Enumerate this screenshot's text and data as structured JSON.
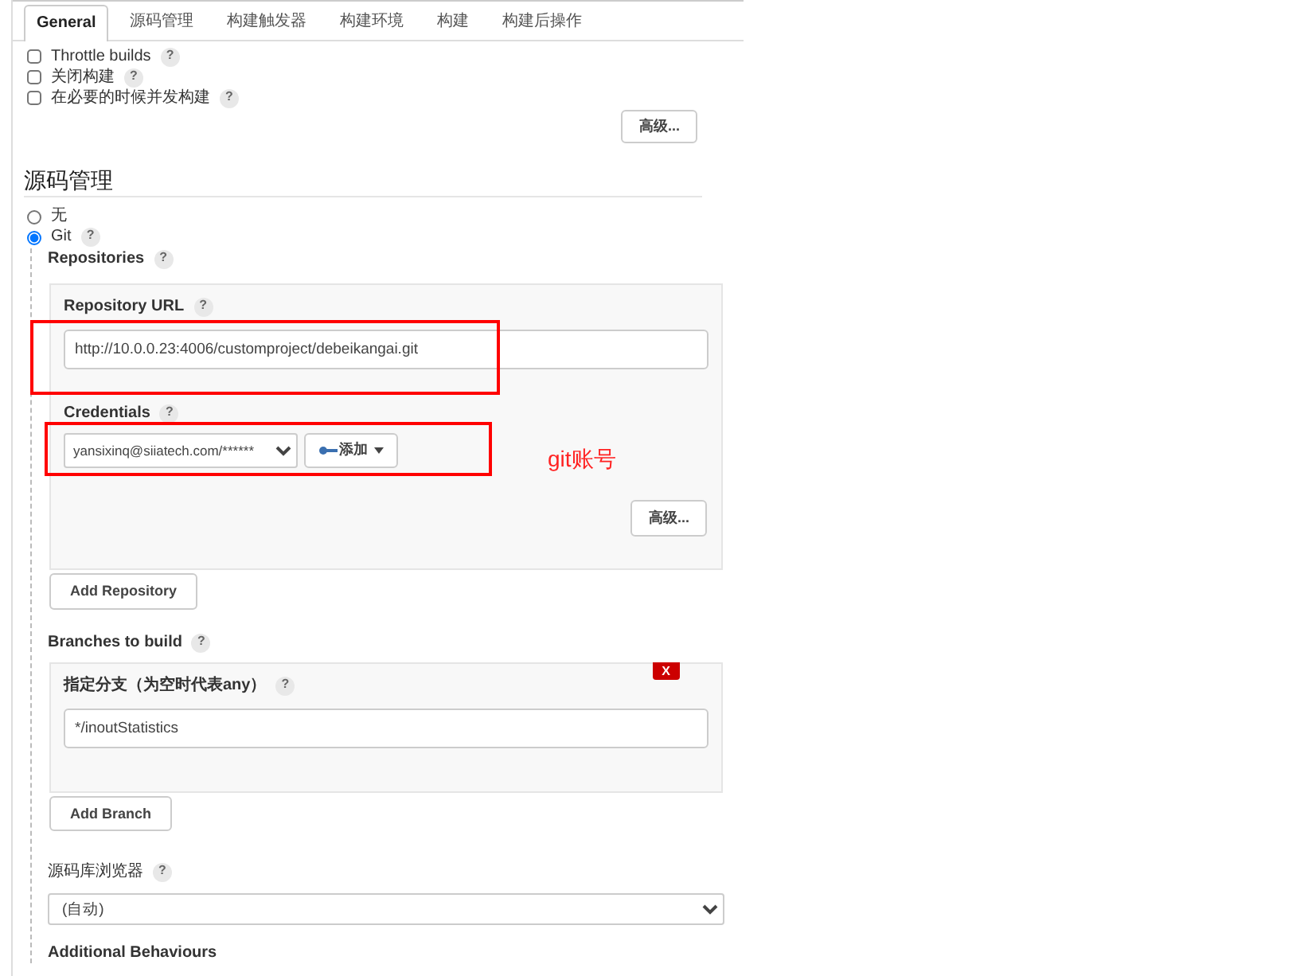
{
  "tabs": [
    {
      "label": "General",
      "selected": true
    },
    {
      "label": "源码管理",
      "selected": false
    },
    {
      "label": "构建触发器",
      "selected": false
    },
    {
      "label": "构建环境",
      "selected": false
    },
    {
      "label": "构建",
      "selected": false
    },
    {
      "label": "构建后操作",
      "selected": false
    }
  ],
  "general_options": [
    {
      "label": "Throttle builds",
      "checked": false,
      "help": "?"
    },
    {
      "label": "关闭构建",
      "checked": false,
      "help": "?"
    },
    {
      "label": "在必要的时候并发构建",
      "checked": false,
      "help": "?"
    }
  ],
  "general_advanced_button": "高级...",
  "section_title": "源码管理",
  "scm_options": [
    {
      "label": "无",
      "selected": false
    },
    {
      "label": "Git",
      "selected": true,
      "help": "?"
    }
  ],
  "repositories": {
    "label": "Repositories",
    "help": "?",
    "url_label": "Repository URL",
    "url_help": "?",
    "url_value": "http://10.0.0.23:4006/customproject/debeikangai.git",
    "credentials_label": "Credentials",
    "credentials_help": "?",
    "credentials_value": "yansixinq@siiatech.com/******",
    "add_button": "添加",
    "advanced_button": "高级...",
    "add_repository_button": "Add Repository"
  },
  "branches": {
    "label": "Branches to build",
    "help": "?",
    "delete_button": "X",
    "spec_label": "指定分支（为空时代表any）",
    "spec_help": "?",
    "spec_value": "*/inoutStatistics",
    "add_branch_button": "Add Branch"
  },
  "repository_browser": {
    "label": "源码库浏览器",
    "help": "?",
    "value": "(自动)"
  },
  "additional_behaviours_label": "Additional Behaviours",
  "annotation": "git账号"
}
